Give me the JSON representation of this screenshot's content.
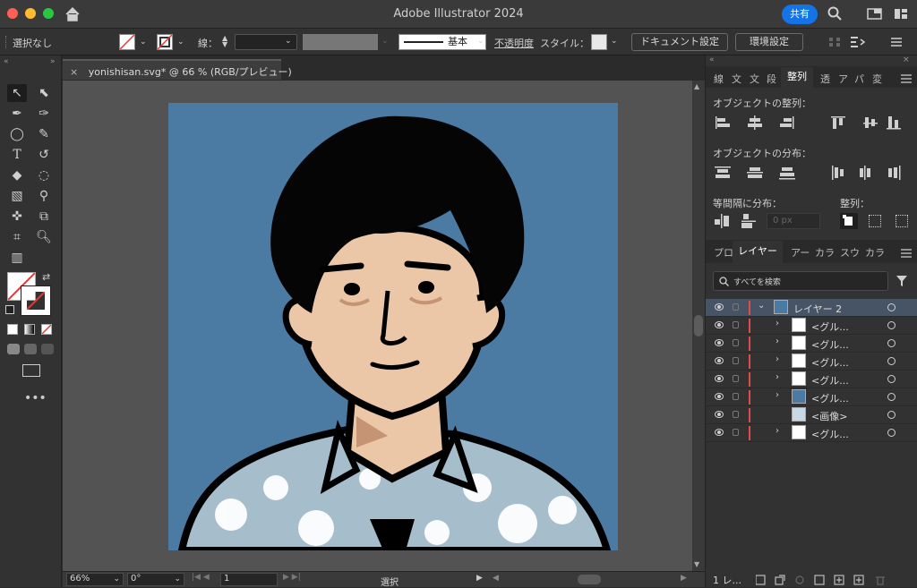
{
  "app": {
    "title": "Adobe Illustrator 2024",
    "share_label": "共有"
  },
  "controlbar": {
    "selection": "選択なし",
    "stroke_label": "線：",
    "stroke_style": "基本",
    "opacity_label": "不透明度",
    "style_label": "スタイル：",
    "doc_settings": "ドキュメント設定",
    "prefs": "環境設定"
  },
  "document": {
    "tab_label": "yonishisan.svg* @ 66 % (RGB/プレビュー)",
    "close": "×"
  },
  "status": {
    "zoom": "66%",
    "rotation": "0°",
    "artboard": "1",
    "mode": "選択"
  },
  "panel": {
    "top_tabs": [
      "線",
      "文",
      "文",
      "段",
      "整列",
      "透",
      "ア",
      "パ",
      "変"
    ],
    "align_title": "オブジェクトの整列：",
    "distribute_title": "オブジェクトの分布：",
    "spacing_title": "等間隔に分布：",
    "align_to_title": "整列：",
    "spacing_value": "0 px",
    "layer_tabs": [
      "プロ",
      "レイヤー",
      "アー",
      "カラ",
      "スウ",
      "カラ"
    ],
    "search_placeholder": "すべてを検索",
    "layers": [
      {
        "name": "レイヤー 2",
        "selected": true
      },
      {
        "name": "<グル..."
      },
      {
        "name": "<グル..."
      },
      {
        "name": "<グル..."
      },
      {
        "name": "<グル..."
      },
      {
        "name": "<グル..."
      },
      {
        "name": "<画像>"
      },
      {
        "name": "<グル..."
      }
    ],
    "footer_count": "1 レ..."
  },
  "colors": {
    "accent": "#1473e6",
    "artboard_bg": "#4b7ba3",
    "skin": "#ebc7a8",
    "shirt": "#9fb9c9"
  }
}
